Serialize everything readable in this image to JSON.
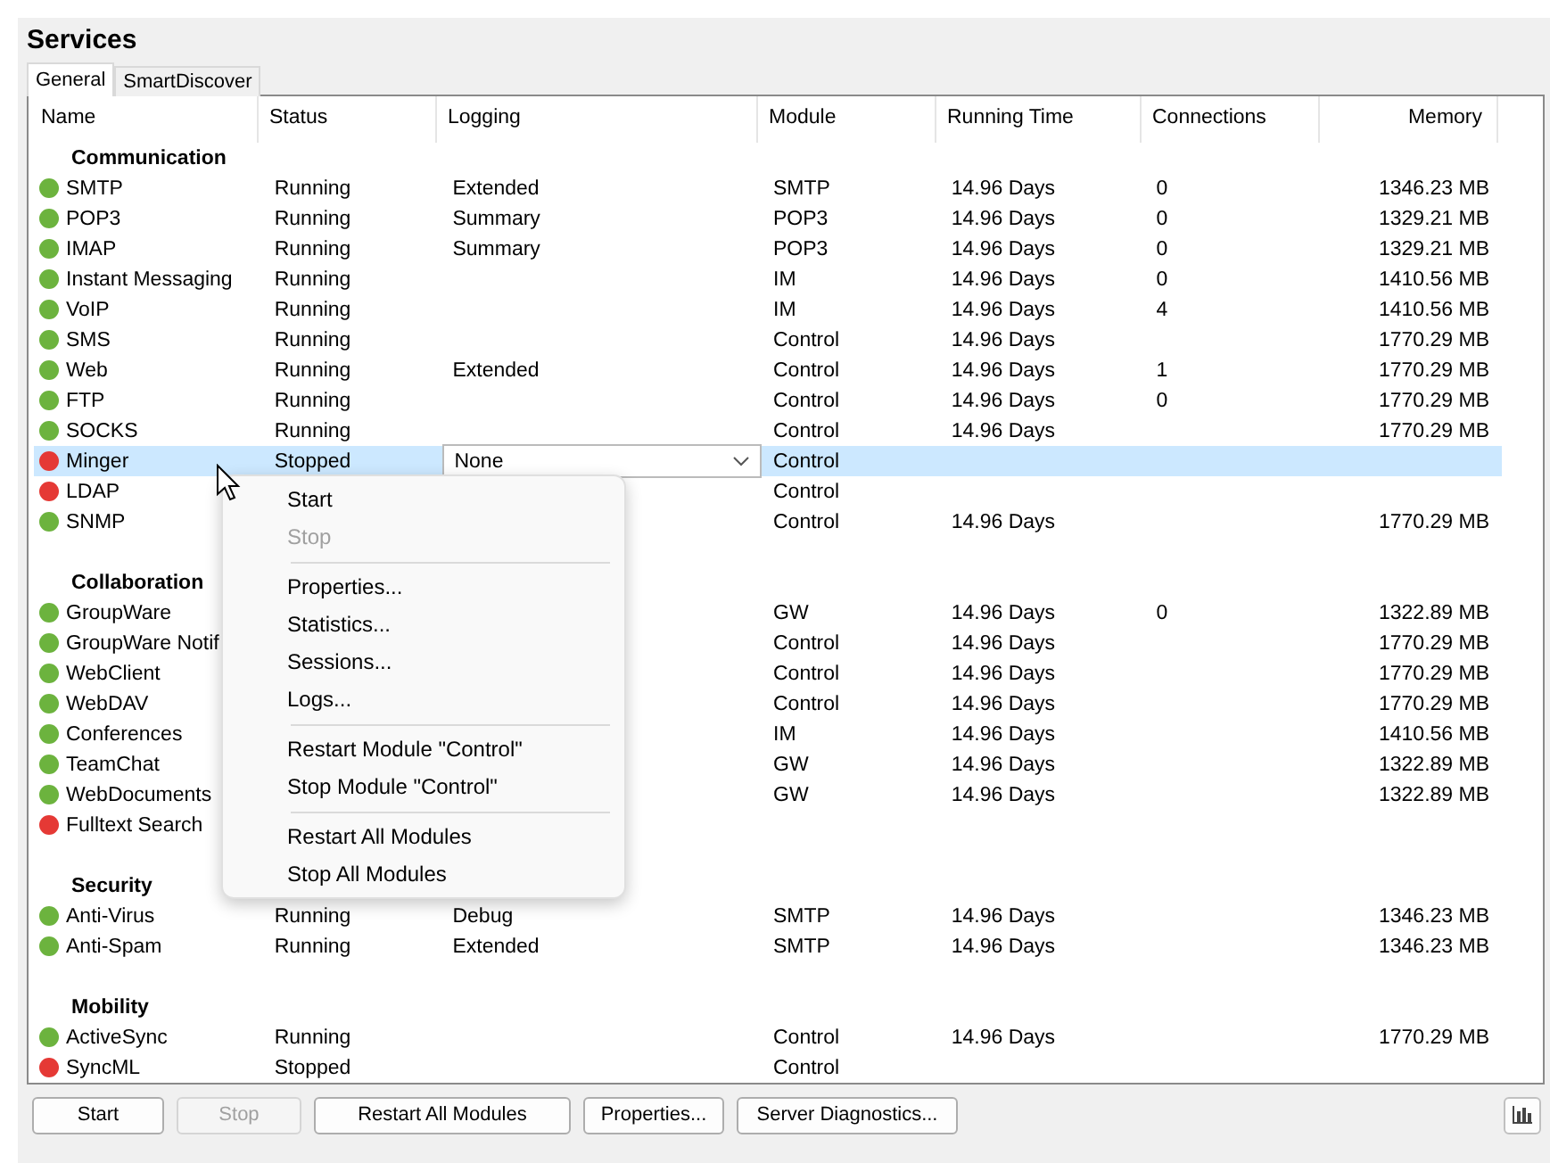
{
  "window": {
    "title": "Services"
  },
  "tabs": [
    {
      "label": "General",
      "selected": true
    },
    {
      "label": "SmartDiscover",
      "selected": false
    }
  ],
  "table": {
    "columns": [
      "Name",
      "Status",
      "Logging",
      "Module",
      "Running Time",
      "Connections",
      "Memory"
    ],
    "groups": [
      {
        "name": "Communication",
        "services": [
          {
            "name": "SMTP",
            "color": "#6cb33e",
            "status": "Running",
            "logging": "Extended",
            "module": "SMTP",
            "running_time": "14.96 Days",
            "connections": "0",
            "memory": "1346.23 MB",
            "selected": false
          },
          {
            "name": "POP3",
            "color": "#6cb33e",
            "status": "Running",
            "logging": "Summary",
            "module": "POP3",
            "running_time": "14.96 Days",
            "connections": "0",
            "memory": "1329.21 MB",
            "selected": false
          },
          {
            "name": "IMAP",
            "color": "#6cb33e",
            "status": "Running",
            "logging": "Summary",
            "module": "POP3",
            "running_time": "14.96 Days",
            "connections": "0",
            "memory": "1329.21 MB",
            "selected": false
          },
          {
            "name": "Instant Messaging",
            "color": "#6cb33e",
            "status": "Running",
            "module": "IM",
            "running_time": "14.96 Days",
            "connections": "0",
            "memory": "1410.56 MB",
            "selected": false
          },
          {
            "name": "VoIP",
            "color": "#6cb33e",
            "status": "Running",
            "module": "IM",
            "running_time": "14.96 Days",
            "connections": "4",
            "memory": "1410.56 MB",
            "selected": false
          },
          {
            "name": "SMS",
            "color": "#6cb33e",
            "status": "Running",
            "module": "Control",
            "running_time": "14.96 Days",
            "memory": "1770.29 MB",
            "selected": false
          },
          {
            "name": "Web",
            "color": "#6cb33e",
            "status": "Running",
            "logging": "Extended",
            "module": "Control",
            "running_time": "14.96 Days",
            "connections": "1",
            "memory": "1770.29 MB",
            "selected": false
          },
          {
            "name": "FTP",
            "color": "#6cb33e",
            "status": "Running",
            "module": "Control",
            "running_time": "14.96 Days",
            "connections": "0",
            "memory": "1770.29 MB",
            "selected": false
          },
          {
            "name": "SOCKS",
            "color": "#6cb33e",
            "status": "Running",
            "module": "Control",
            "running_time": "14.96 Days",
            "memory": "1770.29 MB",
            "selected": false
          },
          {
            "name": "Minger",
            "color": "#e53935",
            "status": "Stopped",
            "logging": "None",
            "module": "Control",
            "selected": true
          },
          {
            "name": "LDAP",
            "color": "#e53935",
            "module": "Control",
            "selected": false
          },
          {
            "name": "SNMP",
            "color": "#6cb33e",
            "module": "Control",
            "running_time": "14.96 Days",
            "memory": "1770.29 MB",
            "selected": false
          }
        ]
      },
      {
        "name": "Collaboration",
        "services": [
          {
            "name": "GroupWare",
            "color": "#6cb33e",
            "module": "GW",
            "running_time": "14.96 Days",
            "connections": "0",
            "memory": "1322.89 MB",
            "selected": false
          },
          {
            "name": "GroupWare Notif",
            "color": "#6cb33e",
            "module": "Control",
            "running_time": "14.96 Days",
            "memory": "1770.29 MB",
            "selected": false
          },
          {
            "name": "WebClient",
            "color": "#6cb33e",
            "module": "Control",
            "running_time": "14.96 Days",
            "memory": "1770.29 MB",
            "selected": false
          },
          {
            "name": "WebDAV",
            "color": "#6cb33e",
            "module": "Control",
            "running_time": "14.96 Days",
            "memory": "1770.29 MB",
            "selected": false
          },
          {
            "name": "Conferences",
            "color": "#6cb33e",
            "module": "IM",
            "running_time": "14.96 Days",
            "memory": "1410.56 MB",
            "selected": false
          },
          {
            "name": "TeamChat",
            "color": "#6cb33e",
            "module": "GW",
            "running_time": "14.96 Days",
            "memory": "1322.89 MB",
            "selected": false
          },
          {
            "name": "WebDocuments",
            "color": "#6cb33e",
            "module": "GW",
            "running_time": "14.96 Days",
            "memory": "1322.89 MB",
            "selected": false
          },
          {
            "name": "Fulltext Search",
            "color": "#e53935",
            "selected": false
          }
        ]
      },
      {
        "name": "Security",
        "services": [
          {
            "name": "Anti-Virus",
            "color": "#6cb33e",
            "status": "Running",
            "logging": "Debug",
            "module": "SMTP",
            "running_time": "14.96 Days",
            "memory": "1346.23 MB",
            "selected": false
          },
          {
            "name": "Anti-Spam",
            "color": "#6cb33e",
            "status": "Running",
            "logging": "Extended",
            "module": "SMTP",
            "running_time": "14.96 Days",
            "memory": "1346.23 MB",
            "selected": false
          }
        ]
      },
      {
        "name": "Mobility",
        "services": [
          {
            "name": "ActiveSync",
            "color": "#6cb33e",
            "status": "Running",
            "module": "Control",
            "running_time": "14.96 Days",
            "memory": "1770.29 MB",
            "selected": false
          },
          {
            "name": "SyncML",
            "color": "#e53935",
            "status": "Stopped",
            "module": "Control",
            "selected": false
          }
        ]
      }
    ]
  },
  "context_menu": {
    "sections": [
      [
        {
          "label": "Start",
          "disabled": false
        },
        {
          "label": "Stop",
          "disabled": true
        }
      ],
      [
        {
          "label": "Properties...",
          "disabled": false
        },
        {
          "label": "Statistics...",
          "disabled": false
        },
        {
          "label": "Sessions...",
          "disabled": false
        },
        {
          "label": "Logs...",
          "disabled": false
        }
      ],
      [
        {
          "label": "Restart Module \"Control\"",
          "disabled": false
        },
        {
          "label": "Stop Module \"Control\"",
          "disabled": false
        }
      ],
      [
        {
          "label": "Restart All Modules",
          "disabled": false
        },
        {
          "label": "Stop All Modules",
          "disabled": false
        }
      ]
    ]
  },
  "buttons": [
    {
      "label": "Start",
      "disabled": false
    },
    {
      "label": "Stop",
      "disabled": true
    },
    {
      "label": "Restart All Modules",
      "disabled": false
    },
    {
      "label": "Properties...",
      "disabled": false
    },
    {
      "label": "Server Diagnostics...",
      "disabled": false
    }
  ]
}
